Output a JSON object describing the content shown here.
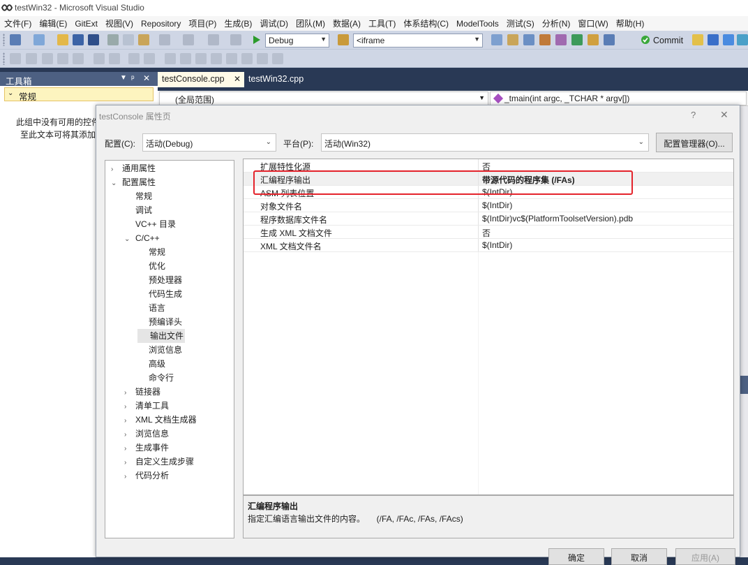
{
  "window": {
    "title": "testWin32 - Microsoft Visual Studio"
  },
  "menu": [
    "文件(F)",
    "编辑(E)",
    "GitExt",
    "视图(V)",
    "Repository",
    "项目(P)",
    "生成(B)",
    "调试(D)",
    "团队(M)",
    "数据(A)",
    "工具(T)",
    "体系结构(C)",
    "ModelTools",
    "测试(S)",
    "分析(N)",
    "窗口(W)",
    "帮助(H)"
  ],
  "toolbar": {
    "config_combo": "Debug",
    "find_combo": "<iframe",
    "commit_label": "Commit"
  },
  "toolbox": {
    "title": "工具箱",
    "group": "常规",
    "empty_text_1": "此组中没有可用的控件",
    "empty_text_2": "至此文本可将其添加"
  },
  "editor": {
    "tabs": [
      "testConsole.cpp",
      "testWin32.cpp"
    ],
    "scope": "(全局范围)",
    "function": "_tmain(int argc, _TCHAR * argv[])"
  },
  "dialog": {
    "title": "testConsole 属性页",
    "help": "?",
    "close": "✕",
    "config_label": "配置(C):",
    "config_value": "活动(Debug)",
    "platform_label": "平台(P):",
    "platform_value": "活动(Win32)",
    "config_manager": "配置管理器(O)...",
    "tree": [
      {
        "label": "通用属性",
        "exp": "›"
      },
      {
        "label": "配置属性",
        "exp": "⌄"
      },
      {
        "label": "常规",
        "exp": ""
      },
      {
        "label": "调试",
        "exp": ""
      },
      {
        "label": "VC++ 目录",
        "exp": ""
      },
      {
        "label": "C/C++",
        "exp": "⌄"
      },
      {
        "label": "常规",
        "exp": ""
      },
      {
        "label": "优化",
        "exp": ""
      },
      {
        "label": "预处理器",
        "exp": ""
      },
      {
        "label": "代码生成",
        "exp": ""
      },
      {
        "label": "语言",
        "exp": ""
      },
      {
        "label": "预编译头",
        "exp": ""
      },
      {
        "label": "输出文件",
        "exp": ""
      },
      {
        "label": "浏览信息",
        "exp": ""
      },
      {
        "label": "高级",
        "exp": ""
      },
      {
        "label": "命令行",
        "exp": ""
      },
      {
        "label": "链接器",
        "exp": "›"
      },
      {
        "label": "清单工具",
        "exp": "›"
      },
      {
        "label": "XML 文档生成器",
        "exp": "›"
      },
      {
        "label": "浏览信息",
        "exp": "›"
      },
      {
        "label": "生成事件",
        "exp": "›"
      },
      {
        "label": "自定义生成步骤",
        "exp": "›"
      },
      {
        "label": "代码分析",
        "exp": "›"
      }
    ],
    "properties": [
      {
        "name": "扩展特性化源",
        "value": "否"
      },
      {
        "name": "汇编程序输出",
        "value": "带源代码的程序集 (/FAs)"
      },
      {
        "name": "ASM 列表位置",
        "value": "$(IntDir)"
      },
      {
        "name": "对象文件名",
        "value": "$(IntDir)"
      },
      {
        "name": "程序数据库文件名",
        "value": "$(IntDir)vc$(PlatformToolsetVersion).pdb"
      },
      {
        "name": "生成 XML 文档文件",
        "value": "否"
      },
      {
        "name": "XML 文档文件名",
        "value": "$(IntDir)"
      }
    ],
    "description_title": "汇编程序输出",
    "description_text": "指定汇编语言输出文件的内容。     (/FA, /FAc, /FAs, /FAcs)",
    "ok": "确定",
    "cancel": "取消",
    "apply": "应用(A)"
  },
  "colors": {
    "highlight_box": "#e4232b",
    "vs_dark": "#293955",
    "toolbar": "#cfd6e5"
  }
}
